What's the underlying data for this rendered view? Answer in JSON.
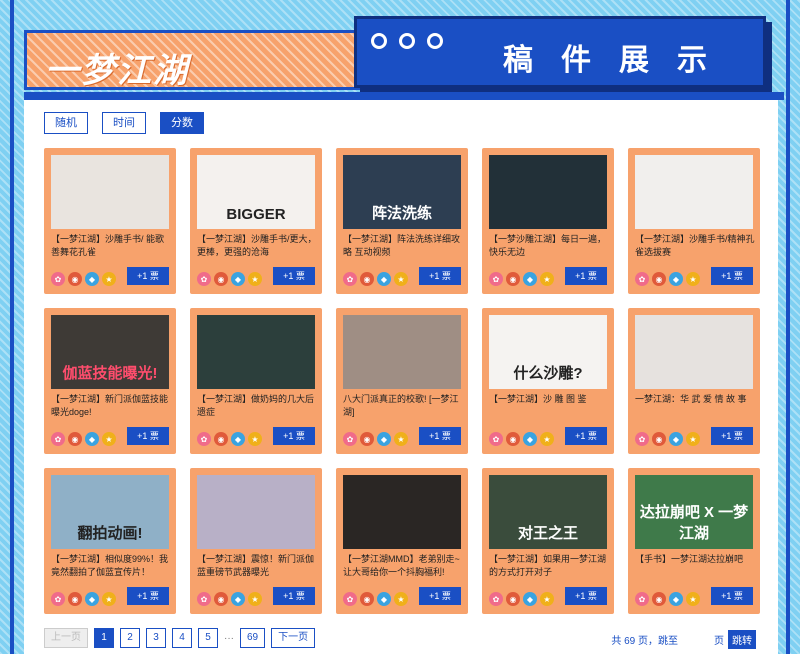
{
  "header": {
    "logo": "一梦江湖",
    "title": "稿件展示"
  },
  "sort": {
    "buttons": [
      "随机",
      "时间",
      "分数"
    ],
    "active": "分数"
  },
  "cards": [
    {
      "title": "【一梦江湖】沙雕手书/ 能歌善舞花孔雀",
      "thumb_text": "",
      "thumb_color": "#e9e4df",
      "vote": "+1 票"
    },
    {
      "title": "【一梦江湖】沙雕手书/更大，更棒，更强的沧海",
      "thumb_text": "BIGGER",
      "thumb_color": "#f4f1ee",
      "vote": "+1 票"
    },
    {
      "title": "【一梦江湖】阵法洗练详细攻略 互动视频",
      "thumb_text": "阵法洗练",
      "thumb_color": "#2d3e52",
      "vote": "+1 票"
    },
    {
      "title": "【一梦沙雕江湖】每日一遍，快乐无边",
      "thumb_text": "",
      "thumb_color": "#223038",
      "vote": "+1 票"
    },
    {
      "title": "【一梦江湖】沙雕手书/精神孔雀选拔赛",
      "thumb_text": "",
      "thumb_color": "#f1efed",
      "vote": "+1 票"
    },
    {
      "title": "【一梦江湖】新门派伽蓝技能曝光doge!",
      "thumb_text": "伽蓝技能曝光!",
      "thumb_color": "#3e3a36",
      "vote": "+1 票"
    },
    {
      "title": "【一梦江湖】做奶妈的几大后遗症",
      "thumb_text": "",
      "thumb_color": "#2c3f3c",
      "vote": "+1 票"
    },
    {
      "title": "八大门派真正的校歌! [一梦江湖]",
      "thumb_text": "",
      "thumb_color": "#9f8e84",
      "vote": "+1 票"
    },
    {
      "title": "【一梦江湖】沙 雕 图 鉴",
      "thumb_text": "什么沙雕?",
      "thumb_color": "#f5f3f1",
      "vote": "+1 票"
    },
    {
      "title": "一梦江湖：华 武 爱 情 故 事",
      "thumb_text": "",
      "thumb_color": "#e6e2df",
      "vote": "+1 票"
    },
    {
      "title": "【一梦江湖】相似度99%！我竟然翻拍了伽蓝宣传片！",
      "thumb_text": "翻拍动画!",
      "thumb_color": "#8fb0c7",
      "vote": "+1 票"
    },
    {
      "title": "【一梦江湖】震惊！新门派伽蓝重磅节武器曝光",
      "thumb_text": "",
      "thumb_color": "#b8b0c7",
      "vote": "+1 票"
    },
    {
      "title": "【一梦江湖MMD】老弟别走~让大哥给你一个抖胸福利!",
      "thumb_text": "",
      "thumb_color": "#2a2624",
      "vote": "+1 票"
    },
    {
      "title": "【一梦江湖】如果用一梦江湖的方式打开对子",
      "thumb_text": "对王之王",
      "thumb_color": "#3a4c3c",
      "vote": "+1 票"
    },
    {
      "title": "【手书】一梦江湖达拉崩吧",
      "thumb_text": "达拉崩吧 X 一梦江湖",
      "thumb_color": "#3f7a4a",
      "vote": "+1 票"
    }
  ],
  "pager": {
    "prev": "上一页",
    "pages": [
      "1",
      "2",
      "3",
      "4",
      "5"
    ],
    "ellipsis": "···",
    "last": "69",
    "next": "下一页",
    "total_prefix": "共 69 页，跳至",
    "total_suffix": "页",
    "jump": "跳转"
  }
}
